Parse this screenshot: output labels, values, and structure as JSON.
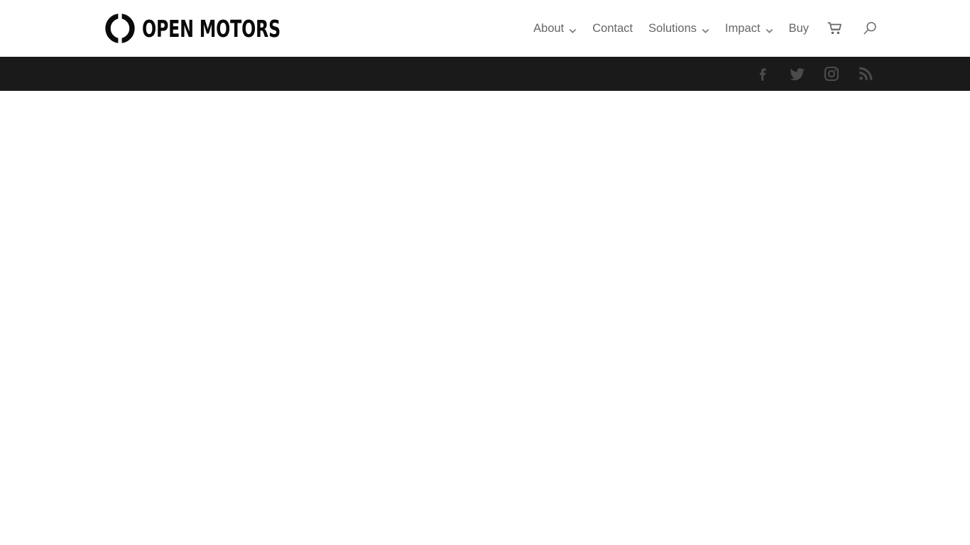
{
  "header": {
    "brand": {
      "logo_icon": "open-motors-ring-icon",
      "wordmark": "OPEN MOTORS"
    },
    "nav_items": [
      {
        "label": "About",
        "has_dropdown": true,
        "icon": "chevron-down-icon"
      },
      {
        "label": "Contact",
        "has_dropdown": false,
        "icon": ""
      },
      {
        "label": "Solutions",
        "has_dropdown": true,
        "icon": "chevron-down-icon"
      },
      {
        "label": "Impact",
        "has_dropdown": true,
        "icon": "chevron-down-icon"
      },
      {
        "label": "Buy",
        "has_dropdown": false,
        "icon": ""
      }
    ],
    "cart_icon": "shopping-cart-icon",
    "search_icon": "search-icon",
    "background_color": "#ffffff",
    "nav_text_color": "#666666"
  },
  "social_bar": {
    "background_color": "#1a1a1a",
    "icon_color": "#4b4b4b",
    "links": [
      {
        "name": "Facebook",
        "icon": "facebook-icon"
      },
      {
        "name": "Twitter",
        "icon": "twitter-icon"
      },
      {
        "name": "Instagram",
        "icon": "instagram-icon"
      },
      {
        "name": "RSS",
        "icon": "rss-icon"
      }
    ]
  },
  "body": {
    "content": "",
    "background_color": "#ffffff"
  }
}
